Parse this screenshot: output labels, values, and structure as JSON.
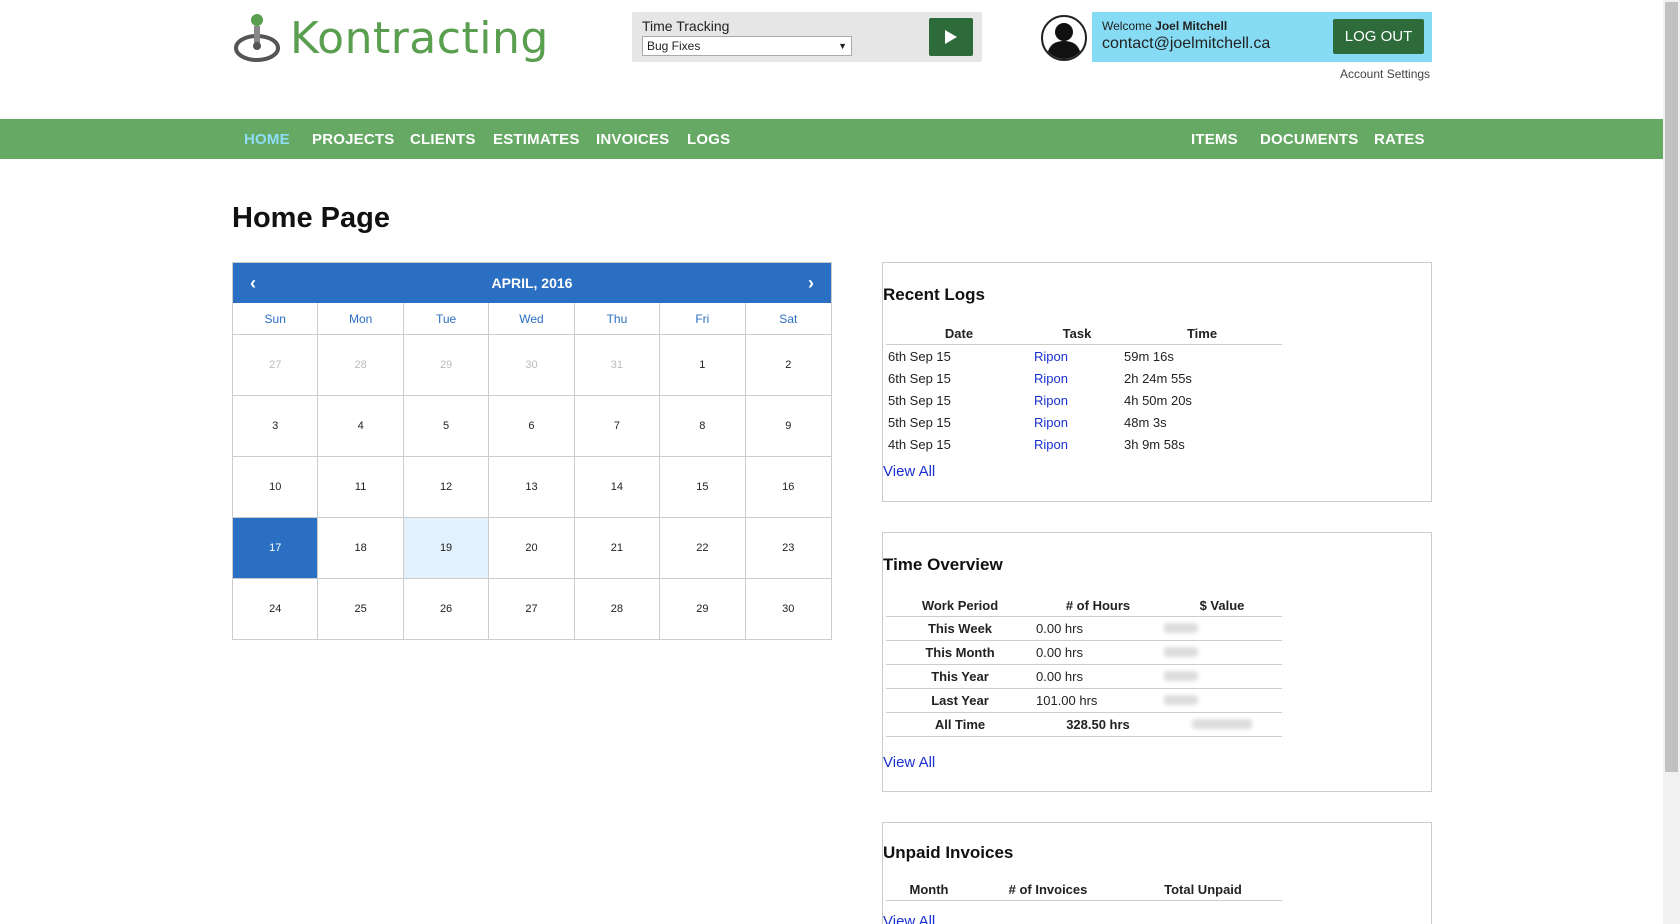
{
  "brand": {
    "name": "Kontracting"
  },
  "timer": {
    "label": "Time Tracking",
    "selected": "Bug Fixes"
  },
  "user": {
    "welcome_prefix": "Welcome",
    "name": "Joel Mitchell",
    "email": "contact@joelmitchell.ca",
    "logout_label": "LOG OUT",
    "account_settings": "Account Settings"
  },
  "nav": {
    "left": [
      "HOME",
      "PROJECTS",
      "CLIENTS",
      "ESTIMATES",
      "INVOICES",
      "LOGS"
    ],
    "right": [
      "ITEMS",
      "DOCUMENTS",
      "RATES"
    ],
    "active": "HOME"
  },
  "page": {
    "title": "Home Page"
  },
  "calendar": {
    "month_label": "APRIL, 2016",
    "weekdays": [
      "Sun",
      "Mon",
      "Tue",
      "Wed",
      "Thu",
      "Fri",
      "Sat"
    ],
    "weeks": [
      [
        "27",
        "28",
        "29",
        "30",
        "31",
        "1",
        "2"
      ],
      [
        "3",
        "4",
        "5",
        "6",
        "7",
        "8",
        "9"
      ],
      [
        "10",
        "11",
        "12",
        "13",
        "14",
        "15",
        "16"
      ],
      [
        "17",
        "18",
        "19",
        "20",
        "21",
        "22",
        "23"
      ],
      [
        "24",
        "25",
        "26",
        "27",
        "28",
        "29",
        "30"
      ]
    ],
    "prev_month_days": [
      "27",
      "28",
      "29",
      "30",
      "31"
    ],
    "selected_day": "17",
    "today_day": "19"
  },
  "recent_logs": {
    "title": "Recent Logs",
    "headers": [
      "Date",
      "Task",
      "Time"
    ],
    "rows": [
      [
        "6th Sep 15",
        "Ripon",
        "59m 16s"
      ],
      [
        "6th Sep 15",
        "Ripon",
        "2h 24m 55s"
      ],
      [
        "5th Sep 15",
        "Ripon",
        "4h 50m 20s"
      ],
      [
        "5th Sep 15",
        "Ripon",
        "48m 3s"
      ],
      [
        "4th Sep 15",
        "Ripon",
        "3h 9m 58s"
      ]
    ],
    "view_all": "View All"
  },
  "time_overview": {
    "title": "Time Overview",
    "headers": [
      "Work Period",
      "# of Hours",
      "$ Value"
    ],
    "rows": [
      [
        "This Week",
        "0.00 hrs"
      ],
      [
        "This Month",
        "0.00 hrs"
      ],
      [
        "This Year",
        "0.00 hrs"
      ],
      [
        "Last Year",
        "101.00 hrs"
      ],
      [
        "All Time",
        "328.50 hrs"
      ]
    ],
    "view_all": "View All"
  },
  "unpaid_invoices": {
    "title": "Unpaid Invoices",
    "headers": [
      "Month",
      "# of Invoices",
      "Total Unpaid"
    ],
    "view_all": "View All"
  },
  "colors": {
    "nav_green": "#66a964",
    "dark_green": "#2e6b3a",
    "calendar_blue": "#2b6fc2",
    "user_box": "#87dcf5",
    "link_blue": "#1a2fd0"
  }
}
